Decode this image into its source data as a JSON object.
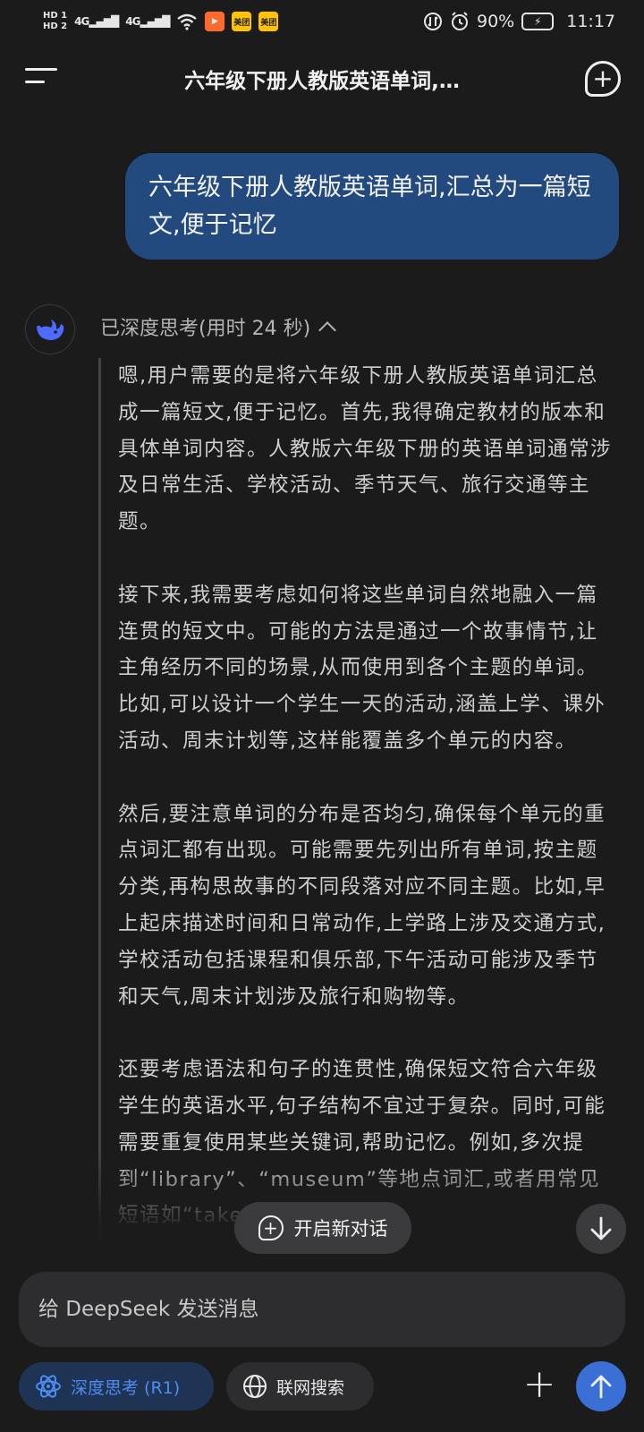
{
  "status_bar": {
    "hd1": "HD 1",
    "hd2": "HD 2",
    "net1": "4G",
    "net2": "4G",
    "app_badge_1": "美团",
    "app_badge_2": "美团",
    "battery": "90%",
    "time": "11:17"
  },
  "header": {
    "title": "六年级下册人教版英语单词,…"
  },
  "user_message": "六年级下册人教版英语单词,汇总为一篇短文,便于记忆",
  "assistant": {
    "thinking_label": "已深度思考(用时 24 秒)",
    "paragraphs": [
      "嗯,用户需要的是将六年级下册人教版英语单词汇总成一篇短文,便于记忆。首先,我得确定教材的版本和具体单词内容。人教版六年级下册的英语单词通常涉及日常生活、学校活动、季节天气、旅行交通等主题。",
      "接下来,我需要考虑如何将这些单词自然地融入一篇连贯的短文中。可能的方法是通过一个故事情节,让主角经历不同的场景,从而使用到各个主题的单词。比如,可以设计一个学生一天的活动,涵盖上学、课外活动、周末计划等,这样能覆盖多个单元的内容。",
      "然后,要注意单词的分布是否均匀,确保每个单元的重点词汇都有出现。可能需要先列出所有单词,按主题分类,再构思故事的不同段落对应不同主题。比如,早上起床描述时间和日常动作,上学路上涉及交通方式,学校活动包括课程和俱乐部,下午活动可能涉及季节和天气,周末计划涉及旅行和购物等。",
      "还要考虑语法和句子的连贯性,确保短文符合六年级学生的英语水平,句子结构不宜过于复杂。同时,可能需要重复使用某些关键词,帮助记忆。例如,多次提到“library”、“museum”等地点词汇,或者用常见短语如“take"
    ]
  },
  "new_conversation_label": "开启新对话",
  "input": {
    "placeholder": "给 DeepSeek 发送消息"
  },
  "toolbar": {
    "deep_think_label": "深度思考 (R1)",
    "web_search_label": "联网搜索"
  },
  "colors": {
    "background": "#1b1b1c",
    "user_bubble": "#234a7f",
    "accent": "#3a6fd6",
    "deep_think_active_bg": "#1f3354"
  }
}
